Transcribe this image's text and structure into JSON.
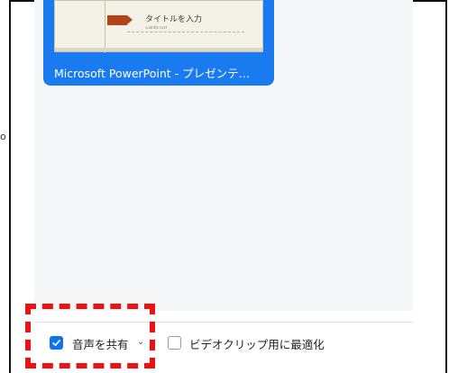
{
  "window": {
    "share_item": {
      "caption": "Microsoft PowerPoint - プレゼンテ…",
      "slide_title": "タイトルを入力",
      "slide_sub": "subtitle text"
    }
  },
  "options": {
    "share_audio": {
      "label": "音声を共有",
      "checked": true,
      "dropdown_icon": "chevron-down-icon"
    },
    "optimize_video": {
      "label": "ビデオクリップ用に最適化",
      "checked": false
    }
  },
  "side_mark": "o",
  "colors": {
    "accent": "#1a7bf1",
    "checkbox": "#0e72ed",
    "highlight": "#ee1111",
    "ribbon": "#b34319"
  }
}
